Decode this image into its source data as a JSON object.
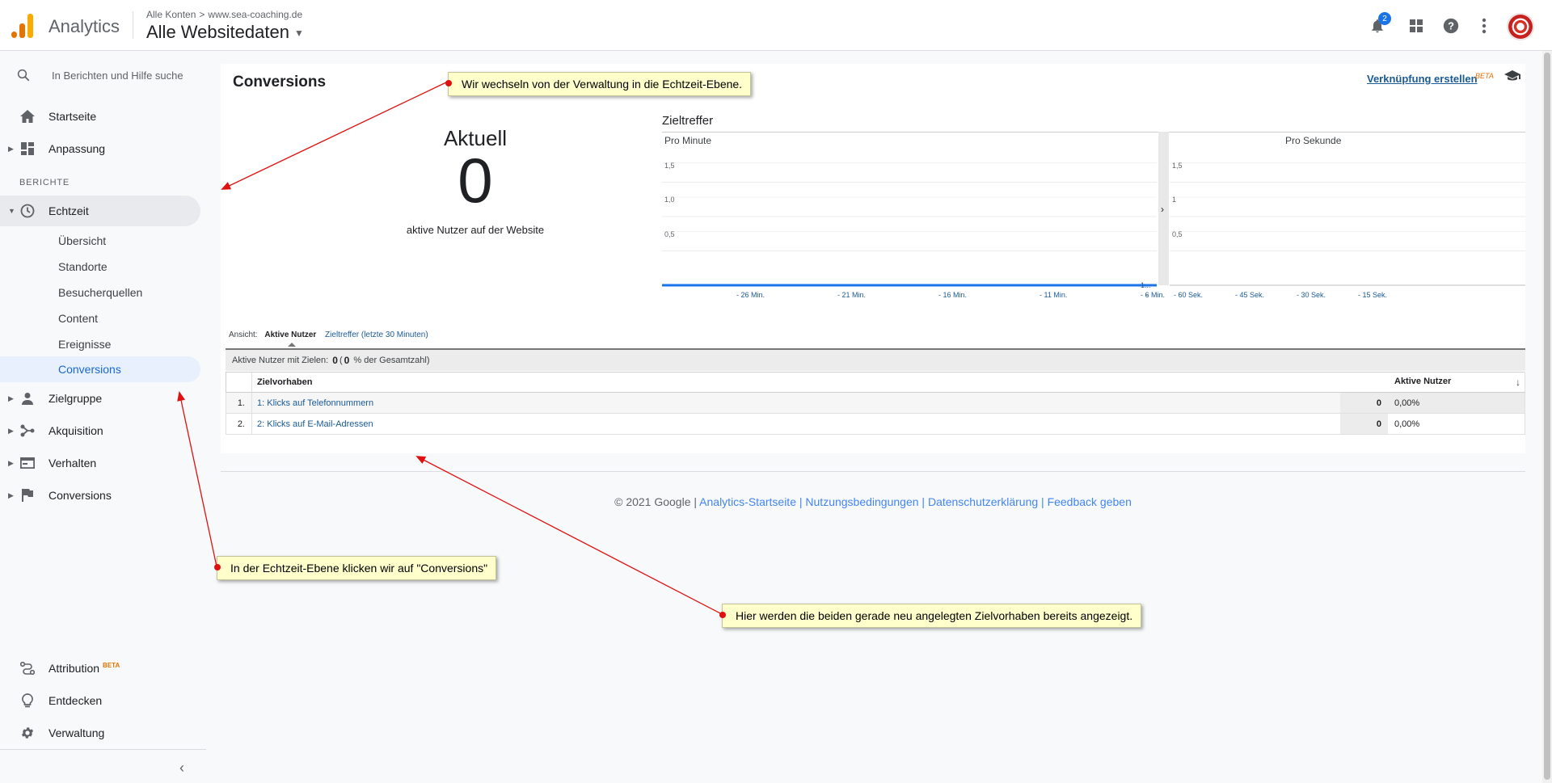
{
  "header": {
    "app_name": "Analytics",
    "breadcrumb_account": "Alle Konten",
    "breadcrumb_separator": ">",
    "breadcrumb_property": "www.sea-coaching.de",
    "view_name": "Alle Websitedaten",
    "notification_count": "2"
  },
  "sidebar": {
    "search_placeholder": "In Berichten und Hilfe suche",
    "home": "Startseite",
    "customization": "Anpassung",
    "reports_section": "BERICHTE",
    "realtime": "Echtzeit",
    "realtime_sub": {
      "overview": "Übersicht",
      "locations": "Standorte",
      "traffic_sources": "Besucherquellen",
      "content": "Content",
      "events": "Ereignisse",
      "conversions": "Conversions"
    },
    "audience": "Zielgruppe",
    "acquisition": "Akquisition",
    "behavior": "Verhalten",
    "conversions": "Conversions",
    "attribution": "Attribution",
    "attribution_badge": "BETA",
    "discover": "Entdecken",
    "admin": "Verwaltung"
  },
  "report": {
    "title": "Conversions",
    "create_shortcut": "Verknüpfung erstellen",
    "beta": "BETA",
    "current_label": "Aktuell",
    "current_value": "0",
    "current_sub": "aktive Nutzer auf der Website",
    "chart_title": "Zieltreffer",
    "per_minute": "Pro Minute",
    "per_second": "Pro Sekunde",
    "view_label": "Ansicht:",
    "tab_active_users": "Aktive Nutzer",
    "tab_goal_hits": "Zieltreffer (letzte 30 Minuten)",
    "summary_prefix": "Aktive Nutzer mit Zielen:",
    "summary_value": "0",
    "summary_pct_open": "(",
    "summary_pct": "0",
    "summary_suffix": "% der Gesamtzahl)",
    "table_header_goal": "Zielvorhaben",
    "table_header_users": "Aktive Nutzer",
    "rows": [
      {
        "index": "1.",
        "goal": "1: Klicks auf Telefonnummern",
        "users": "0",
        "pct": "0,00%"
      },
      {
        "index": "2.",
        "goal": "2: Klicks auf E-Mail-Adressen",
        "users": "0",
        "pct": "0,00%"
      }
    ]
  },
  "chart_data": [
    {
      "type": "bar",
      "title": "Pro Minute",
      "categories": [
        "- 26 Min.",
        "- 21 Min.",
        "- 16 Min.",
        "- 11 Min.",
        "- 6 Min.",
        "-"
      ],
      "values": [
        0,
        0,
        0,
        0,
        0,
        0
      ],
      "yticks": [
        "0,5",
        "1,0",
        "1,5"
      ],
      "ylim": [
        0,
        2
      ],
      "last_label": "1..."
    },
    {
      "type": "bar",
      "title": "Pro Sekunde",
      "categories": [
        "- 60 Sek.",
        "- 45 Sek.",
        "- 30 Sek.",
        "- 15 Sek."
      ],
      "values": [
        0,
        0,
        0,
        0
      ],
      "yticks": [
        "0,5",
        "1",
        "1,5"
      ],
      "ylim": [
        0,
        2
      ]
    }
  ],
  "footer": {
    "copyright": "© 2021 Google |",
    "link_home": "Analytics-Startseite",
    "sep": "|",
    "link_terms": "Nutzungsbedingungen",
    "link_privacy": "Datenschutzerklärung",
    "link_feedback": "Feedback geben"
  },
  "annotations": {
    "note1": "Wir wechseln von der Verwaltung in die Echtzeit-Ebene.",
    "note2": "In der Echtzeit-Ebene klicken wir auf \"Conversions\"",
    "note3": "Hier werden die beiden gerade neu angelegten Zielvorhaben bereits angezeigt."
  },
  "colors": {
    "accent": "#1a73e8",
    "link": "#1a5a96",
    "selected_bg": "#e8f0fe",
    "callout_bg": "#ffffcc",
    "arrow": "#e01010"
  }
}
